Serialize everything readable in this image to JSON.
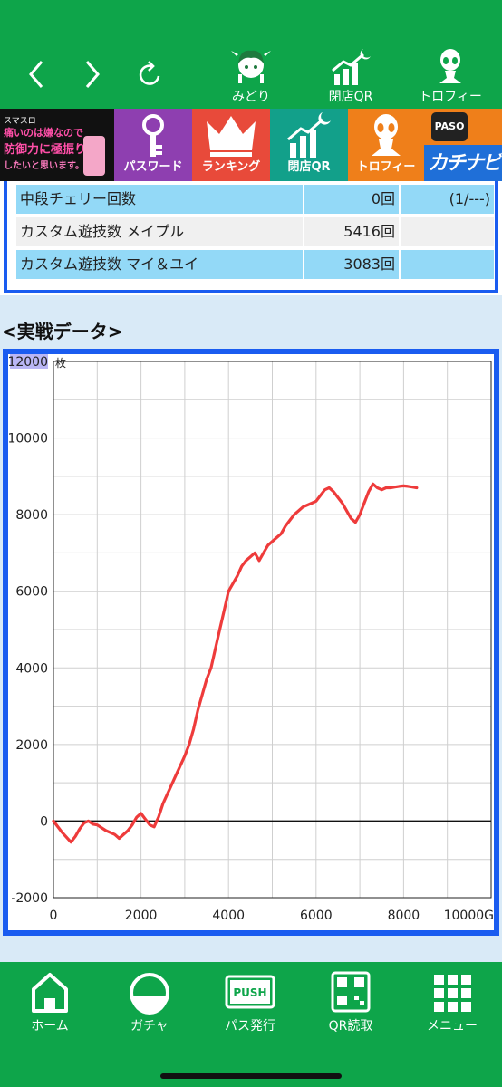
{
  "nav": {
    "back_icon": "chevron-left-icon",
    "forward_icon": "chevron-right-icon",
    "reload_icon": "reload-icon",
    "items": [
      {
        "label": "みどり",
        "icon": "character-icon"
      },
      {
        "label": "閉店QR",
        "icon": "chart-moon-icon"
      },
      {
        "label": "トロフィー",
        "icon": "alien-icon"
      }
    ]
  },
  "banner": {
    "promo_lines": [
      "スマスロ",
      "痛いのは嫌なので",
      "防御力に極振り",
      "したいと思います。"
    ],
    "tiles": [
      {
        "label": "パスワード",
        "color": "#8e3fb0",
        "icon": "key-icon"
      },
      {
        "label": "ランキング",
        "color": "#e84a3a",
        "icon": "crown-icon"
      },
      {
        "label": "閉店QR",
        "color": "#12a08a",
        "icon": "chart-moon-icon"
      },
      {
        "label": "トロフィー",
        "color": "#ef7f1a",
        "icon": "alien-icon"
      }
    ],
    "paso_label": "PASO",
    "brand_label": "カチナビ",
    "brand_color": "#1f6fd8"
  },
  "stats": [
    {
      "name": "中段チェリー回数",
      "value": "0回",
      "ratio": "(1/---)"
    },
    {
      "name": "カスタム遊技数 メイプル",
      "value": "5416回",
      "ratio": ""
    },
    {
      "name": "カスタム遊技数 マイ＆ユイ",
      "value": "3083回",
      "ratio": ""
    }
  ],
  "section_title": "<実戦データ>",
  "chart_data": {
    "type": "line",
    "ylabel": "枚",
    "xlim": [
      0,
      10000
    ],
    "ylim": [
      -2000,
      12000
    ],
    "x_ticks": [
      "0",
      "2000",
      "4000",
      "6000",
      "8000",
      "10000G"
    ],
    "y_ticks": [
      "-2000",
      "0",
      "2000",
      "4000",
      "6000",
      "8000",
      "10000",
      "12000"
    ],
    "highlighted_tick": "12000",
    "grid": true,
    "line_color": "#ee3b3b",
    "series": [
      {
        "x": [
          0,
          200,
          400,
          500,
          600,
          700,
          800,
          900,
          1000,
          1200,
          1400,
          1500,
          1700,
          1800,
          1900,
          2000,
          2100,
          2200,
          2300,
          2400,
          2500,
          2600,
          2700,
          2800,
          2900,
          3000,
          3100,
          3200,
          3300,
          3400,
          3500,
          3600,
          3700,
          3800,
          3900,
          4000,
          4100,
          4200,
          4300,
          4400,
          4500,
          4600,
          4700,
          4800,
          4900,
          5000,
          5100,
          5200,
          5300,
          5400,
          5500,
          5600,
          5700,
          5800,
          5900,
          6000,
          6100,
          6200,
          6300,
          6400,
          6500,
          6600,
          6700,
          6800,
          6900,
          7000,
          7100,
          7200,
          7300,
          7400,
          7500,
          7600,
          7700,
          7800,
          7900,
          8000,
          8100,
          8200,
          8300
        ],
        "y": [
          0,
          -300,
          -550,
          -400,
          -200,
          -50,
          0,
          -80,
          -100,
          -250,
          -350,
          -450,
          -250,
          -100,
          100,
          200,
          50,
          -100,
          -150,
          100,
          450,
          700,
          950,
          1200,
          1450,
          1700,
          2000,
          2400,
          2900,
          3300,
          3700,
          4000,
          4500,
          5000,
          5500,
          6000,
          6200,
          6400,
          6650,
          6800,
          6900,
          7000,
          6800,
          7000,
          7200,
          7300,
          7400,
          7500,
          7700,
          7850,
          8000,
          8100,
          8200,
          8250,
          8300,
          8350,
          8500,
          8650,
          8700,
          8600,
          8450,
          8300,
          8100,
          7900,
          7800,
          8000,
          8300,
          8600,
          8800,
          8700,
          8650,
          8700,
          8700,
          8720,
          8740,
          8750,
          8740,
          8720,
          8700
        ]
      }
    ]
  },
  "bottom_nav": [
    {
      "label": "ホーム",
      "icon": "home-icon"
    },
    {
      "label": "ガチャ",
      "icon": "gacha-icon"
    },
    {
      "label": "パス発行",
      "icon": "push-icon",
      "icon_text": "PUSH"
    },
    {
      "label": "QR読取",
      "icon": "qr-icon"
    },
    {
      "label": "メニュー",
      "icon": "menu-grid-icon"
    }
  ]
}
